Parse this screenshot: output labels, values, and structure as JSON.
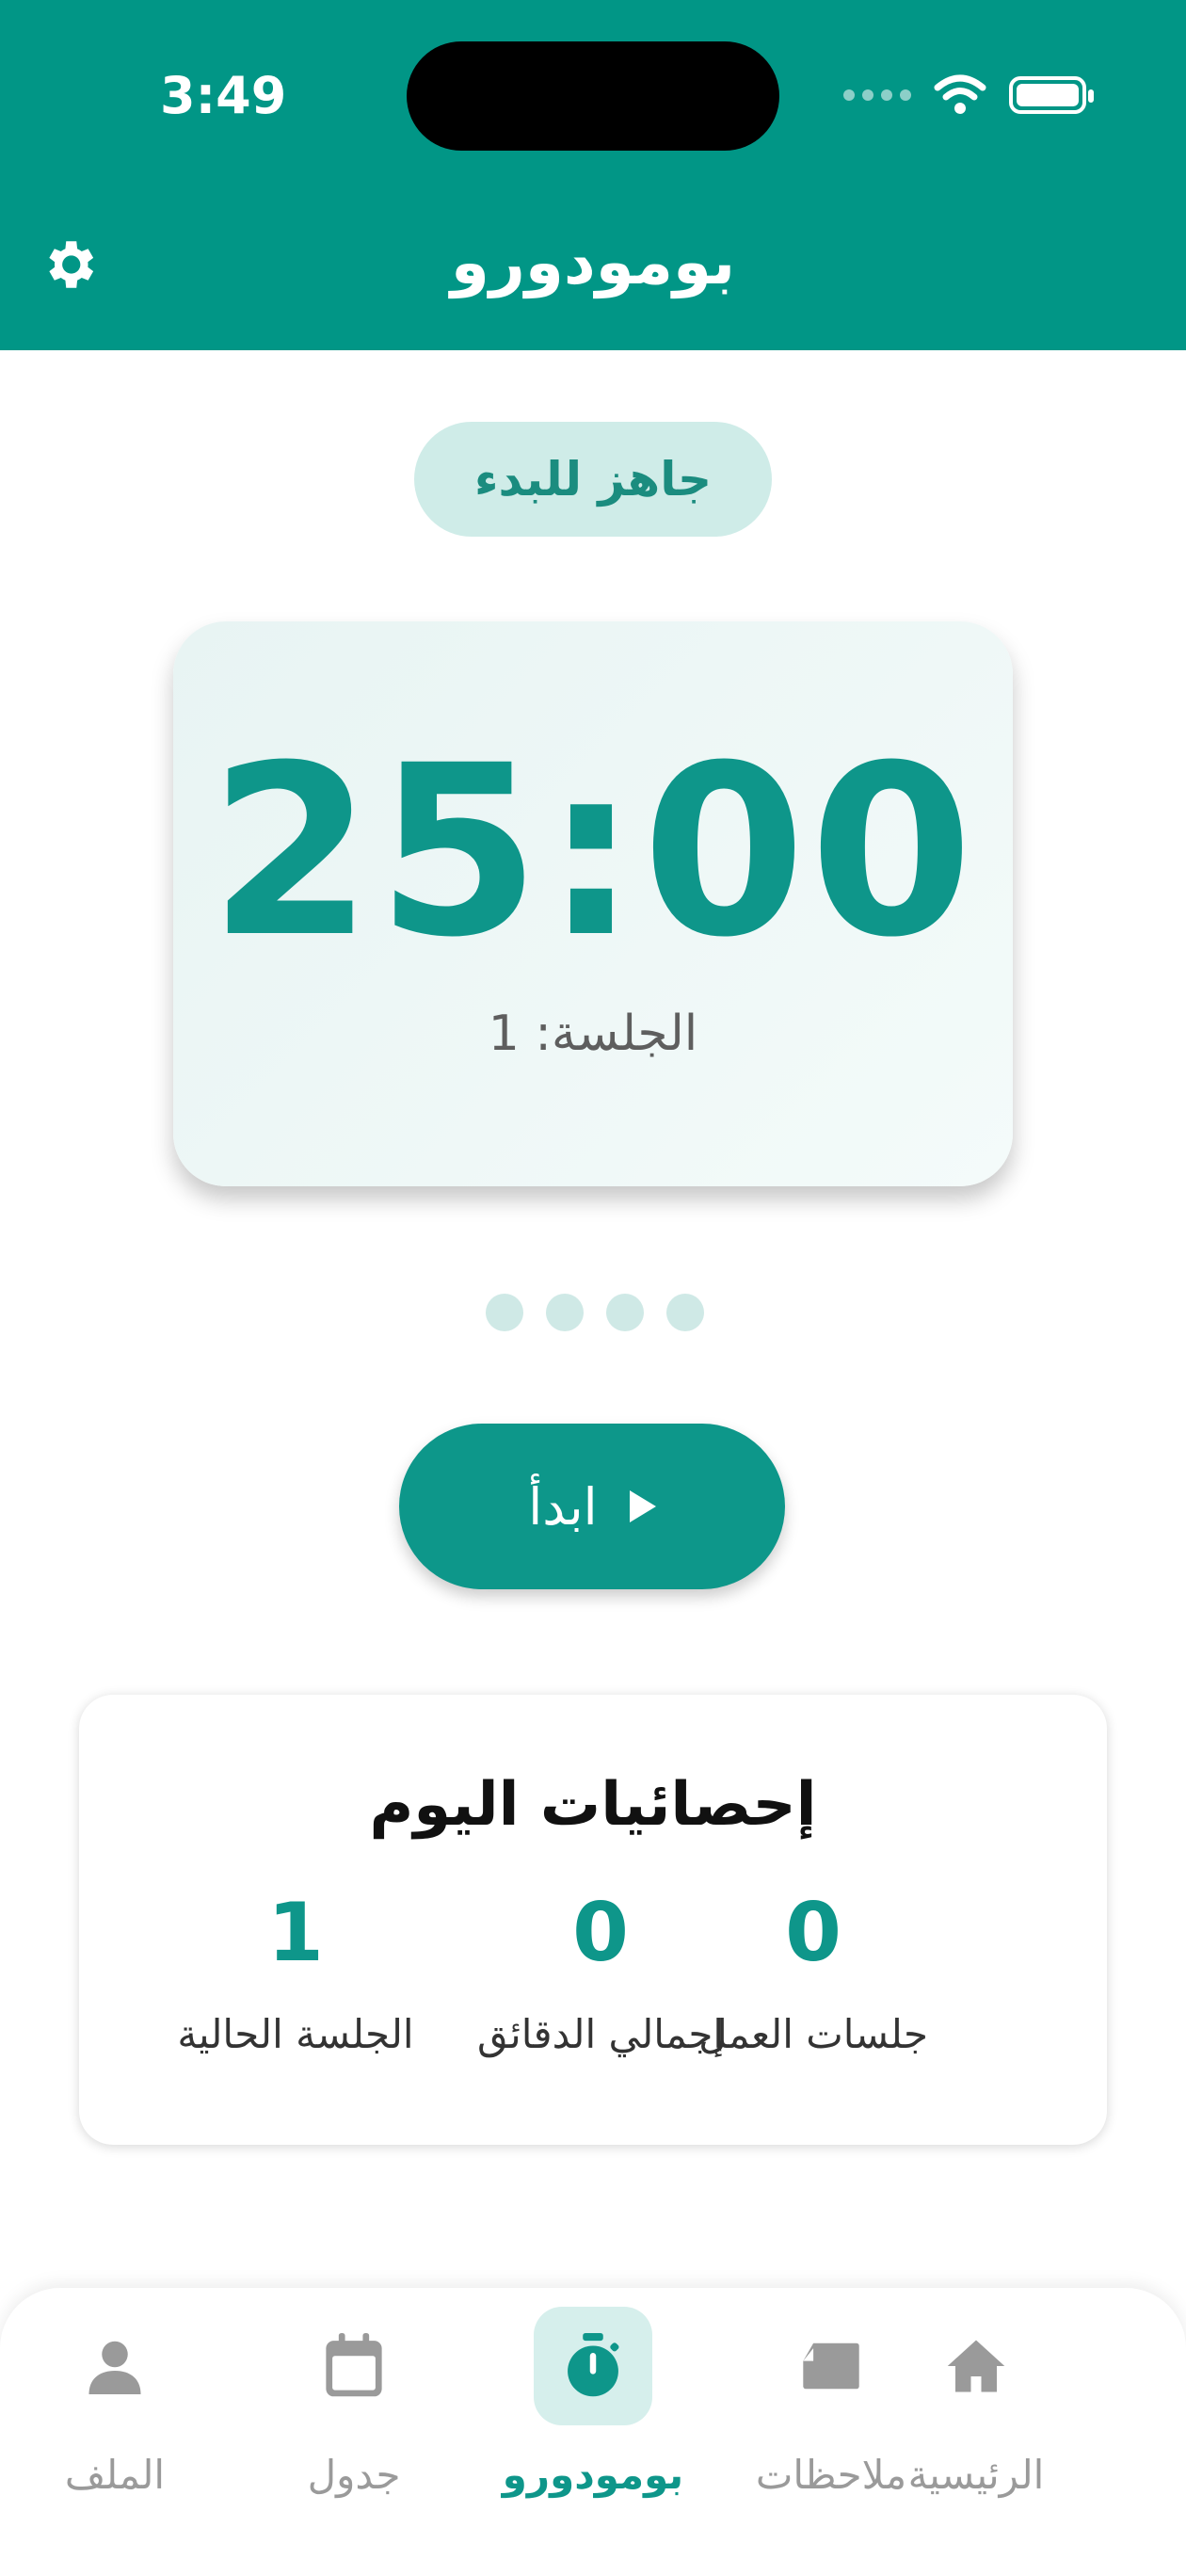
{
  "status_bar": {
    "time": "3:49"
  },
  "header": {
    "title": "بومودورو"
  },
  "timer": {
    "status": "جاهز للبدء",
    "value": "25:00",
    "session_label": "الجلسة: 1"
  },
  "controls": {
    "start_label": "ابدأ"
  },
  "stats": {
    "title": "إحصائيات اليوم",
    "items": [
      {
        "value": "0",
        "label": "جلسات العمل"
      },
      {
        "value": "0",
        "label": "إجمالي الدقائق"
      },
      {
        "value": "1",
        "label": "الجلسة الحالية"
      }
    ]
  },
  "nav": {
    "items": [
      {
        "label": "الرئيسية",
        "icon": "home-icon"
      },
      {
        "label": "ملاحظات",
        "icon": "notes-icon"
      },
      {
        "label": "بومودورو",
        "icon": "stopwatch-icon",
        "active": true
      },
      {
        "label": "جدول",
        "icon": "calendar-icon"
      },
      {
        "label": "الملف",
        "icon": "person-icon"
      }
    ]
  },
  "colors": {
    "primary": "#019686",
    "accent_light": "#cfece8",
    "text_muted": "#9a9a9a"
  }
}
